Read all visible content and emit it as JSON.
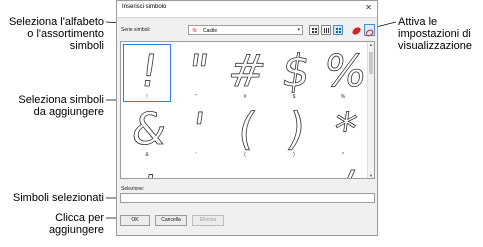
{
  "callouts": {
    "alphabet": "Seleziona l'alfabeto o l'assortimento simboli",
    "display": "Attiva le impostazioni di visualizzazione",
    "symbols": "Seleziona simboli da aggiungere",
    "selected": "Simboli selezionati",
    "add": "Clicca per aggiungere"
  },
  "dialog": {
    "title": "Inserisci simbolo",
    "close": "✕",
    "set_label": "Serie simboli",
    "set_value": "Castle",
    "selection_label": "Selezione:",
    "buttons": {
      "ok": "OK",
      "cancel": "Cancella",
      "delete": "Elimina"
    }
  },
  "symbols": [
    {
      "char": "!",
      "label": "!"
    },
    {
      "char": "\"",
      "label": "\""
    },
    {
      "char": "#",
      "label": "#"
    },
    {
      "char": "$",
      "label": "$"
    },
    {
      "char": "%",
      "label": "%"
    },
    {
      "char": "&",
      "label": "&"
    },
    {
      "char": "'",
      "label": "'"
    },
    {
      "char": "(",
      "label": "("
    },
    {
      "char": ")",
      "label": ")"
    },
    {
      "char": "*",
      "label": "*"
    },
    {
      "char": "+",
      "label": ""
    },
    {
      "char": ",",
      "label": ""
    },
    {
      "char": "-",
      "label": ""
    },
    {
      "char": ".",
      "label": ""
    },
    {
      "char": "/",
      "label": ""
    }
  ],
  "icons": {
    "list_view": "list-view-icon",
    "grid_view": "grid-view-icon",
    "large_grid": "large-grid-view-icon",
    "color": "color-fill-icon",
    "outline": "outline-view-icon"
  },
  "colors": {
    "selection": "#2f7fd6",
    "accent_red": "#d22222"
  }
}
